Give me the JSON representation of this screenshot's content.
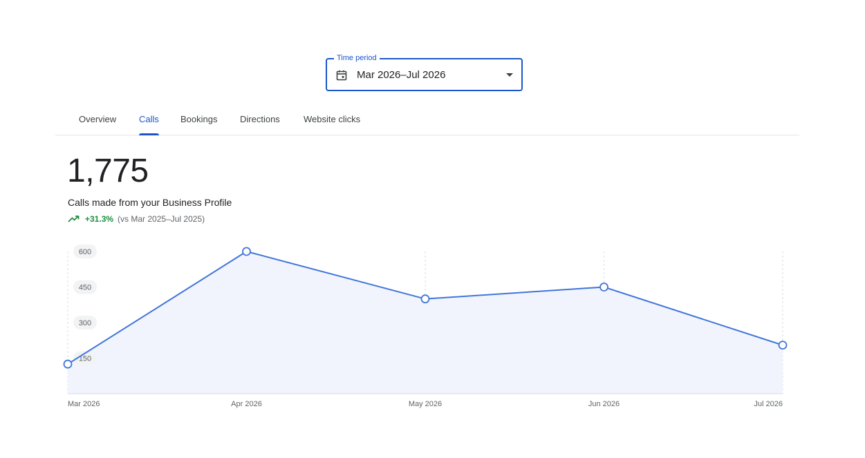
{
  "time_period": {
    "label": "Time period",
    "value": "Mar 2026–Jul 2026",
    "icon": "calendar-icon"
  },
  "tabs": [
    {
      "label": "Overview",
      "active": false
    },
    {
      "label": "Calls",
      "active": true
    },
    {
      "label": "Bookings",
      "active": false
    },
    {
      "label": "Directions",
      "active": false
    },
    {
      "label": "Website clicks",
      "active": false
    }
  ],
  "metric": {
    "value": "1,775",
    "caption": "Calls made from your Business Profile",
    "change": "+31.3%",
    "comparison": "(vs Mar 2025–Jul 2025)",
    "trend_icon": "trending-up-icon"
  },
  "colors": {
    "accent": "#1a56c9",
    "line": "#3f74d9",
    "area": "#f1f4fc",
    "positive": "#1e8e3e"
  },
  "chart_data": {
    "type": "area",
    "categories": [
      "Mar 2026",
      "Apr 2026",
      "May 2026",
      "Jun 2026",
      "Jul 2026"
    ],
    "values": [
      125,
      600,
      400,
      450,
      205
    ],
    "yticks": [
      150,
      300,
      450,
      600
    ],
    "ylim": [
      0,
      600
    ],
    "grid": "vertical dashed"
  }
}
